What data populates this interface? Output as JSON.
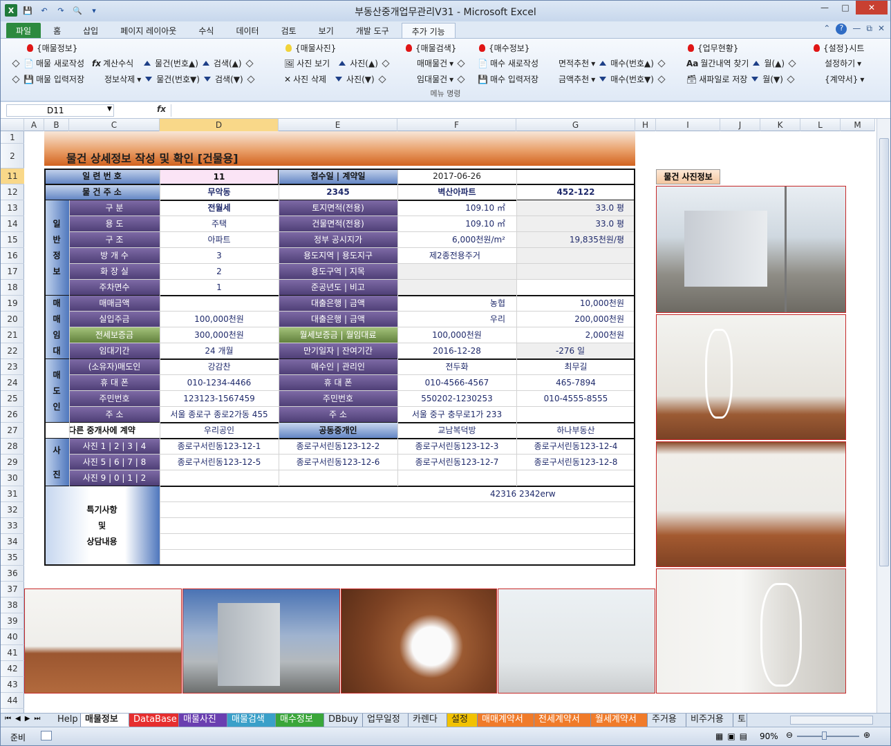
{
  "window": {
    "title": "부동산중개업무관리V31  -  Microsoft Excel"
  },
  "ribbon_tabs": [
    "파일",
    "홈",
    "삽입",
    "페이지 레이아웃",
    "수식",
    "데이터",
    "검토",
    "보기",
    "개발 도구",
    "추가 기능"
  ],
  "ribbon": {
    "group_label": "메뉴 명령",
    "g1": {
      "title": "{매물정보}",
      "new": "매물 새로작성",
      "calc": "계산수식",
      "save": "매물 입력저장",
      "del": "정보삭제",
      "up": "물건(번호▲)",
      "dn": "물건(번호▼)",
      "sup": "검색(▲)",
      "sdn": "검색(▼)"
    },
    "g2": {
      "title": "{매물사진}",
      "view": "사진 보기",
      "del": "사진 삭제",
      "up": "사진(▲)",
      "dn": "사진(▼)"
    },
    "g3": {
      "title": "{매물검색}",
      "sale": "매매물건",
      "rent": "임대물건"
    },
    "g4": {
      "title": "{매수정보}",
      "new": "매수 새로작성",
      "save": "매수 입력저장",
      "area": "면적추천",
      "price": "금액추천",
      "up": "매수(번호▲)",
      "dn": "매수(번호▼)"
    },
    "g5": {
      "title": "{업무현황}",
      "find": "월간내역 찾기",
      "newfile": "새파일로 저장",
      "mup": "월(▲)",
      "mdn": "월(▼)"
    },
    "g6": {
      "title": "{설정}시트",
      "set": "설정하기",
      "contract": "{계약서}"
    }
  },
  "formula": {
    "namebox": "D11",
    "fx": "fx"
  },
  "columns": [
    "A",
    "B",
    "C",
    "D",
    "E",
    "F",
    "G",
    "H",
    "I",
    "J",
    "K",
    "L",
    "M"
  ],
  "rows": [
    "1",
    "2",
    "11",
    "12",
    "13",
    "14",
    "15",
    "16",
    "17",
    "18",
    "19",
    "20",
    "21",
    "22",
    "23",
    "24",
    "25",
    "26",
    "27",
    "28",
    "29",
    "30",
    "31",
    "32",
    "33",
    "34",
    "35",
    "36",
    "37",
    "38",
    "39",
    "40",
    "41",
    "42",
    "43",
    "44"
  ],
  "sheet": {
    "banner": "물건 상세정보 작성 및 확인 [건물용]",
    "photo_header": "물건 사진정보",
    "r11": {
      "lab": "일 련 번 호",
      "val": "11",
      "lab2": "접수일 | 계약일",
      "date": "2017-06-26"
    },
    "r12": {
      "lab": "물 건 주 소",
      "a": "무악동",
      "b": "2345",
      "c": "벽산아파트",
      "d": "452-122"
    },
    "gen_side": [
      "일",
      "반",
      "정",
      "보"
    ],
    "gen": [
      {
        "l": "구   분",
        "v": "전월세",
        "l2": "토지면적(전용)",
        "v2": "109.10 ㎡",
        "v3": "33.0 평"
      },
      {
        "l": "용   도",
        "v": "주택",
        "l2": "건물면적(전용)",
        "v2": "109.10 ㎡",
        "v3": "33.0 평"
      },
      {
        "l": "구   조",
        "v": "아파트",
        "l2": "정부 공시지가",
        "v2": "6,000천원/m²",
        "v3": "19,835천원/평"
      },
      {
        "l": "방 개 수",
        "v": "3",
        "l2": "용도지역 | 용도지구",
        "v2": "제2종전용주거",
        "v3": ""
      },
      {
        "l": "화 장 실",
        "v": "2",
        "l2": "용도구역 | 지목",
        "v2": "",
        "v3": ""
      },
      {
        "l": "주차면수",
        "v": "1",
        "l2": "준공년도 | 비고",
        "v2": "",
        "v3": ""
      }
    ],
    "trade_side": [
      "매",
      "매",
      "임",
      "대"
    ],
    "trade": [
      {
        "l": "매매금액",
        "v": "",
        "l2": "대출은행 | 금액",
        "v2": "농협",
        "v3": "10,000천원"
      },
      {
        "l": "실입주금",
        "v": "100,000천원",
        "l2": "대출은행 | 금액",
        "v2": "우리",
        "v3": "200,000천원"
      },
      {
        "l": "전세보증금",
        "v": "300,000천원",
        "l2": "월세보증금 | 월임대료",
        "v2": "100,000천원",
        "v3": "2,000천원"
      },
      {
        "l": "임대기간",
        "v": "24 개월",
        "l2": "만기일자 | 잔여기간",
        "v2": "2016-12-28",
        "v3": "-276 일"
      }
    ],
    "seller_side": [
      "매",
      "도",
      "인"
    ],
    "seller": [
      {
        "l": "(소유자)매도인",
        "v": "강감찬",
        "l2": "매수인 | 관리인",
        "v2": "전두화",
        "v3": "최무길"
      },
      {
        "l": "휴 대 폰",
        "v": "010-1234-4466",
        "l2": "휴 대 폰",
        "v2": "010-4566-4567",
        "v3": "465-7894"
      },
      {
        "l": "주민번호",
        "v": "123123-1567459",
        "l2": "주민번호",
        "v2": "550202-1230253",
        "v3": "010-4555-8555"
      },
      {
        "l": "주   소",
        "v": "서울 종로구 종로2가동 455",
        "l2": "주   소",
        "v2": "서울 중구 충무로1가 233",
        "v3": ""
      }
    ],
    "r27": {
      "lab": "다른 중개사에 계약",
      "v": "우리공인",
      "lab2": "공동중개인",
      "v2": "교남복덕방",
      "v3": "하나부동산"
    },
    "photo_side": [
      "사",
      "진"
    ],
    "photos": [
      {
        "l": "사진 1 | 2 | 3 | 4",
        "a": "종로구서린동123-12-1",
        "b": "종로구서린동123-12-2",
        "c": "종로구서린동123-12-3",
        "d": "종로구서린동123-12-4"
      },
      {
        "l": "사진 5 | 6 | 7 | 8",
        "a": "종로구서린동123-12-5",
        "b": "종로구서린동123-12-6",
        "c": "종로구서린동123-12-7",
        "d": "종로구서린동123-12-8"
      },
      {
        "l": "사진 9 | 0 | 1 | 2",
        "a": "",
        "b": "",
        "c": "",
        "d": ""
      }
    ],
    "notes_label": [
      "특기사항",
      "및",
      "상담내용"
    ],
    "notes_text": "42316  2342erw"
  },
  "sheet_tabs": [
    "Help",
    "매물정보",
    "DataBase",
    "매물사진",
    "매물검색",
    "매수정보",
    "DBbuy",
    "업무일정",
    "카렌다",
    "설정",
    "매매계약서",
    "전세계약서",
    "월세계약서",
    "주거용",
    "비주거용",
    "토"
  ],
  "status": {
    "ready": "준비",
    "zoom": "90%"
  },
  "colors": {
    "accent": "#2c8a3f",
    "banner": "#d2631f",
    "label": "#4d3d75"
  }
}
